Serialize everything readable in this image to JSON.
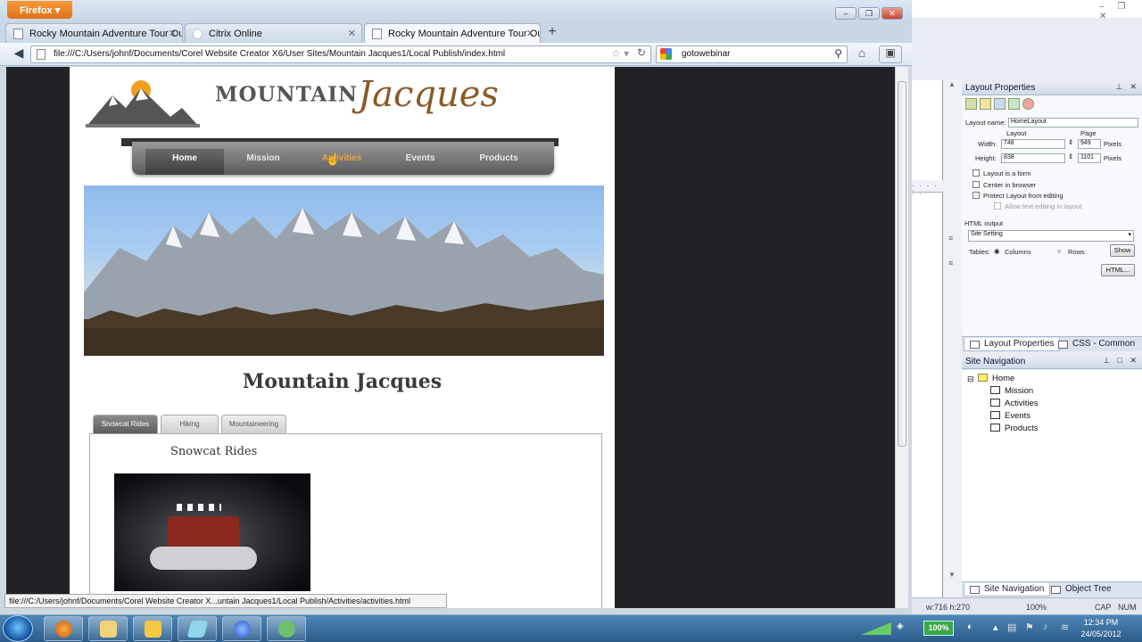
{
  "browser": {
    "menu_button": "Firefox",
    "tabs": [
      {
        "label": "Rocky Mountain Adventure Tour Out...",
        "active": false
      },
      {
        "label": "Citrix Online",
        "active": false
      },
      {
        "label": "Rocky Mountain Adventure Tour Out...",
        "active": true
      }
    ],
    "url": "file:///C:/Users/johnf/Documents/Corel Website Creator X6/User Sites/Mountain Jacques1/Local Publish/index.html",
    "search_value": "gotowebinar",
    "status_url": "file:///C:/Users/johnf/Documents/Corel Website Creator X...untain Jacques1/Local Publish/Activities/activities.html"
  },
  "site": {
    "logo_word1": "MOUNTAIN",
    "logo_word2": "Jacques",
    "menu": [
      "Home",
      "Mission",
      "Activities",
      "Events",
      "Products"
    ],
    "title": "Mountain Jacques",
    "tabs": [
      "Snowcat Rides",
      "Hiking",
      "Mountaineering"
    ],
    "panel_heading": "Snowcat Rides"
  },
  "layout_panel": {
    "title": "Layout Properties",
    "name_label": "Layout name:",
    "name_value": "HomeLayout",
    "col_layout": "Layout",
    "col_page": "Page",
    "width_label": "Width:",
    "width_layout": "748",
    "width_page": "949",
    "height_label": "Height:",
    "height_layout": "838",
    "height_page": "1101",
    "pixels": "Pixels",
    "opt_form": "Layout is a form",
    "opt_center": "Center in browser",
    "opt_protect": "Protect Layout from editing",
    "opt_allow": "Allow text editing in layout",
    "html_output_label": "HTML output",
    "html_output_value": "Site Setting",
    "tables_label": "Tables:",
    "columns": "Columns",
    "rows": "Rows",
    "show_button": "Show",
    "html_button": "HTML..."
  },
  "panel_tabs_1": [
    "Layout Properties",
    "CSS - Common"
  ],
  "site_nav": {
    "title": "Site Navigation",
    "root": "Home",
    "children": [
      "Mission",
      "Activities",
      "Events",
      "Products"
    ]
  },
  "panel_tabs_2": [
    "Site Navigation",
    "Object Tree"
  ],
  "corel_status": {
    "coords": "w:716 h:270",
    "zoom": "100%",
    "cap": "CAP",
    "num": "NUM"
  },
  "taskbar": {
    "zoom_badge": "100%",
    "time": "12:34 PM",
    "date": "24/05/2012"
  },
  "colors": {
    "firefox_orange": "#e8801f",
    "menu_active": "#f0a33a",
    "page_dark": "#212226"
  }
}
